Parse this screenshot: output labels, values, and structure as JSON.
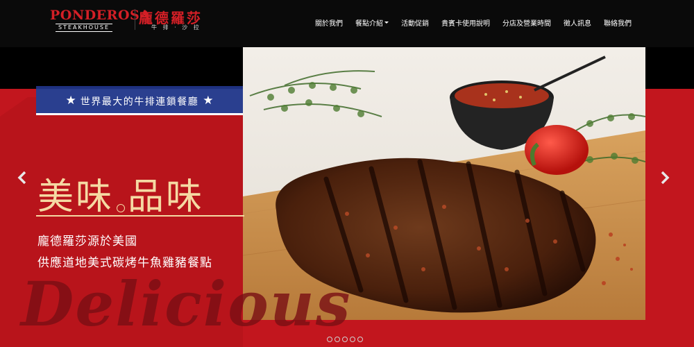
{
  "logo": {
    "en": "PONDEROSA",
    "en_sub": "STEAKHOUSE",
    "cn": "龐德羅莎",
    "cn_sub": "牛 排 · 沙 拉"
  },
  "nav": [
    {
      "label": "關於我們"
    },
    {
      "label": "餐點介紹",
      "has_dropdown": true
    },
    {
      "label": "活動促銷"
    },
    {
      "label": "貴賓卡使用說明"
    },
    {
      "label": "分店及營業時間"
    },
    {
      "label": "徵人訊息"
    },
    {
      "label": "聯絡我們"
    }
  ],
  "hero": {
    "banner": "世界最大的牛排連鎖餐廳",
    "headline_left": "美味",
    "headline_right": "品味",
    "desc_line1": "龐德羅莎源於美國",
    "desc_line2": "供應道地美式碳烤牛魚雞豬餐點",
    "script_word": "Delicious"
  },
  "carousel": {
    "slides": 5,
    "active_index": 0
  },
  "colors": {
    "header_bg": "#0a0a0a",
    "brand_red": "#c2161e",
    "banner_blue": "#2a3f8f",
    "headline_gold": "#f5d9a3"
  },
  "icons": {
    "prev": "chevron-left-icon",
    "next": "chevron-right-icon",
    "star": "star-icon"
  }
}
